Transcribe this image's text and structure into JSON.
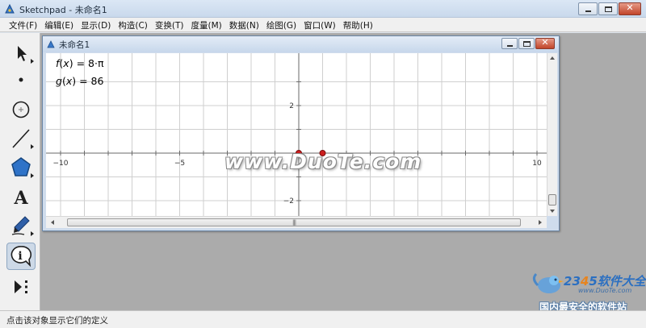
{
  "window": {
    "title": "Sketchpad  - 未命名1",
    "icons": {
      "app": "sketchpad-app-icon",
      "minimize": "minimize-icon",
      "maximize": "maximize-icon",
      "close": "close-icon"
    }
  },
  "menubar": {
    "items": [
      {
        "label": "文件(F)"
      },
      {
        "label": "编辑(E)"
      },
      {
        "label": "显示(D)"
      },
      {
        "label": "构造(C)"
      },
      {
        "label": "变换(T)"
      },
      {
        "label": "度量(M)"
      },
      {
        "label": "数据(N)"
      },
      {
        "label": "绘图(G)"
      },
      {
        "label": "窗口(W)"
      },
      {
        "label": "帮助(H)"
      }
    ]
  },
  "toolbox": {
    "tools": [
      {
        "name": "arrow-select-tool",
        "icon": "arrow-icon"
      },
      {
        "name": "point-tool",
        "icon": "point-icon"
      },
      {
        "name": "compass-tool",
        "icon": "circle-icon"
      },
      {
        "name": "straightedge-tool",
        "icon": "segment-icon"
      },
      {
        "name": "polygon-tool",
        "icon": "pentagon-icon"
      },
      {
        "name": "text-tool",
        "icon": "text-a-icon",
        "glyph": "A"
      },
      {
        "name": "marker-tool",
        "icon": "marker-pen-icon"
      },
      {
        "name": "information-tool",
        "icon": "info-icon",
        "glyph": "i",
        "active": true
      },
      {
        "name": "custom-tool",
        "icon": "custom-tool-icon"
      }
    ]
  },
  "document": {
    "title": "未命名1",
    "functions": [
      {
        "name": "f",
        "var": "x",
        "expr": " = 8·π"
      },
      {
        "name": "g",
        "var": "x",
        "expr": " = 86"
      }
    ],
    "graph": {
      "x_range": [
        -12,
        12
      ],
      "y_range": [
        -3.5,
        3.5
      ],
      "x_tick_labels": [
        "−10",
        "−5",
        "5",
        "10"
      ],
      "x_tick_values": [
        -10,
        -5,
        5,
        10
      ],
      "y_tick_labels": [
        "2",
        "−2"
      ],
      "y_tick_values": [
        2,
        -2
      ],
      "points": [
        {
          "name": "origin-point",
          "x": 0,
          "y": 0
        },
        {
          "name": "unit-point",
          "x": 1,
          "y": 0
        }
      ],
      "point_color": "#cc1f1f",
      "grid_color": "#cfcfcf",
      "axis_color": "#6a6a6a"
    }
  },
  "statusbar": {
    "text": "点击该对象显示它们的定义"
  },
  "watermarks": {
    "center": "www.DuoTe.com",
    "brand_prefix": "2",
    "brand_mid": "3",
    "brand_s": "4",
    "brand_suffix": "5软件大全",
    "url": "www.DuoTe.com",
    "slogan": "国内最安全的软件站"
  }
}
